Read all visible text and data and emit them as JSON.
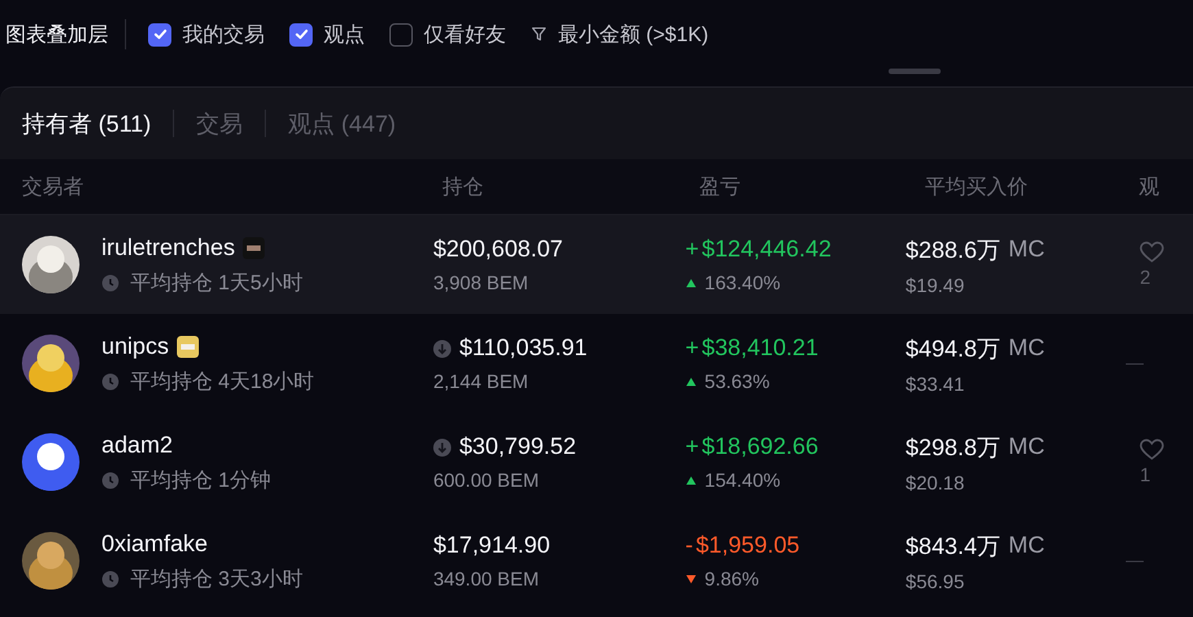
{
  "overlay_bar": {
    "title": "图表叠加层",
    "options": [
      {
        "label": "我的交易",
        "checked": true
      },
      {
        "label": "观点",
        "checked": true
      },
      {
        "label": "仅看好友",
        "checked": false
      }
    ],
    "filter": "最小金额 (>$1K)"
  },
  "tabs": [
    {
      "label": "持有者 (511)",
      "selected": true
    },
    {
      "label": "交易",
      "selected": false
    },
    {
      "label": "观点 (447)",
      "selected": false
    }
  ],
  "table": {
    "columns": [
      "交易者",
      "持仓",
      "盈亏",
      "平均买入价",
      "观"
    ],
    "rows": [
      {
        "name": "iruletrenches",
        "hold_time": "平均持仓 1天5小时",
        "holding": "$200,608.07",
        "amount": "3,908 BEM",
        "sold": false,
        "pnl_sign": "+",
        "pnl": "$124,446.42",
        "loss": false,
        "pnl_pct": "163.40%",
        "avg_mc": "$288.6万",
        "mc_unit": "MC",
        "avg_price": "$19.49",
        "view": {
          "kind": "heart",
          "count": "2"
        },
        "highlighted": true
      },
      {
        "name": "unipcs",
        "hold_time": "平均持仓 4天18小时",
        "holding": "$110,035.91",
        "amount": "2,144 BEM",
        "sold": true,
        "pnl_sign": "+",
        "pnl": "$38,410.21",
        "loss": false,
        "pnl_pct": "53.63%",
        "avg_mc": "$494.8万",
        "mc_unit": "MC",
        "avg_price": "$33.41",
        "view": {
          "kind": "dash"
        },
        "highlighted": false
      },
      {
        "name": "adam2",
        "hold_time": "平均持仓 1分钟",
        "holding": "$30,799.52",
        "amount": "600.00 BEM",
        "sold": true,
        "pnl_sign": "+",
        "pnl": "$18,692.66",
        "loss": false,
        "pnl_pct": "154.40%",
        "avg_mc": "$298.8万",
        "mc_unit": "MC",
        "avg_price": "$20.18",
        "view": {
          "kind": "heart",
          "count": "1"
        },
        "highlighted": false
      },
      {
        "name": "0xiamfake",
        "hold_time": "平均持仓 3天3小时",
        "holding": "$17,914.90",
        "amount": "349.00 BEM",
        "sold": false,
        "pnl_sign": "-",
        "pnl": "$1,959.05",
        "loss": true,
        "pnl_pct": "9.86%",
        "avg_mc": "$843.4万",
        "mc_unit": "MC",
        "avg_price": "$56.95",
        "view": {
          "kind": "dash"
        },
        "highlighted": false
      }
    ]
  }
}
